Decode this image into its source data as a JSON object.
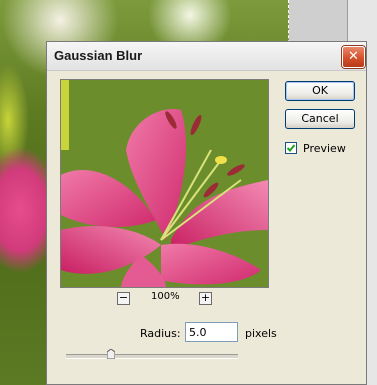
{
  "dialog": {
    "title": "Gaussian Blur",
    "close_label": "✕",
    "ok_label": "OK",
    "cancel_label": "Cancel",
    "preview_label": "Preview",
    "preview_checked": true,
    "zoom": {
      "minus_label": "−",
      "plus_label": "+",
      "value": "100%"
    },
    "radius": {
      "label": "Radius:",
      "value": "5.0",
      "unit": "pixels",
      "slider_fraction": 0.27
    }
  },
  "colors": {
    "dialog_bg": "#ece9d8",
    "close_button": "#d4502c",
    "flower_pink": "#e0447f",
    "background_green": "#5d7a21"
  },
  "icons": [
    "close-icon",
    "zoom-minus-icon",
    "zoom-plus-icon",
    "checkmark-icon",
    "slider-thumb-icon"
  ]
}
